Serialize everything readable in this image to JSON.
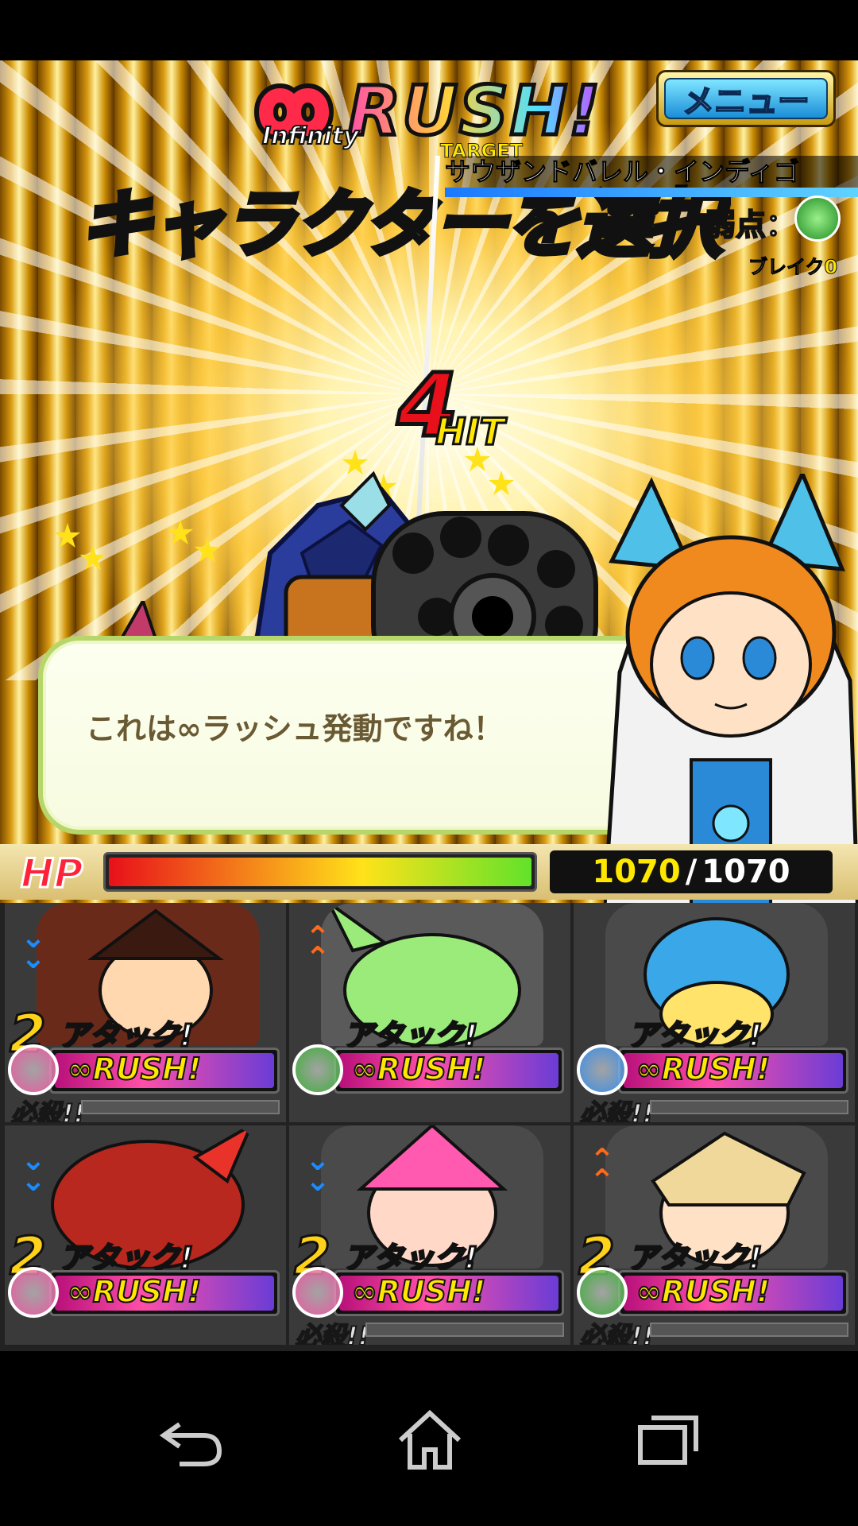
{
  "header": {
    "rush_logo": "RUSH!",
    "rush_sub": "Infinity",
    "menu_label": "メニュー"
  },
  "target": {
    "label": "TARGET",
    "enemy_name": "サウザンドバレル・インディゴ",
    "weakness_label": "弱点：",
    "weakness_element": "wind-leaf-element",
    "break_label": "ブレイク",
    "break_count": "0"
  },
  "banner": {
    "instruction": "キャラクターを選択して！"
  },
  "combo": {
    "hits": "4",
    "hit_label": "HIT"
  },
  "dialog": {
    "text": "これは∞ラッシュ発動ですね！"
  },
  "hp": {
    "label": "HP",
    "current": "1070",
    "separator": "/",
    "max": "1070",
    "fraction": 1.0
  },
  "party": [
    {
      "combo": "2",
      "attack": "アタック!",
      "rush": "∞RUSH!",
      "special": "必殺!!",
      "element": "fire",
      "arrow": "down"
    },
    {
      "combo": "",
      "attack": "アタック!",
      "rush": "∞RUSH!",
      "special": "",
      "element": "wind",
      "arrow": "up"
    },
    {
      "combo": "",
      "attack": "アタック!",
      "rush": "∞RUSH!",
      "special": "必殺!!",
      "element": "water",
      "arrow": ""
    },
    {
      "combo": "2",
      "attack": "アタック!",
      "rush": "∞RUSH!",
      "special": "",
      "element": "fire",
      "arrow": "down"
    },
    {
      "combo": "2",
      "attack": "アタック!",
      "rush": "∞RUSH!",
      "special": "必殺!!",
      "element": "fire",
      "arrow": "down"
    },
    {
      "combo": "2",
      "attack": "アタック!",
      "rush": "∞RUSH!",
      "special": "必殺!!",
      "element": "wind",
      "arrow": "up"
    }
  ],
  "colors": {
    "fire": "#e85aa0",
    "wind": "#3fae3a",
    "water": "#3a8ee8",
    "arrow_down": "#1a8cff",
    "arrow_up": "#ff6a1a"
  },
  "navigation": {
    "back": "back-icon",
    "home": "home-icon",
    "recents": "recents-icon"
  }
}
